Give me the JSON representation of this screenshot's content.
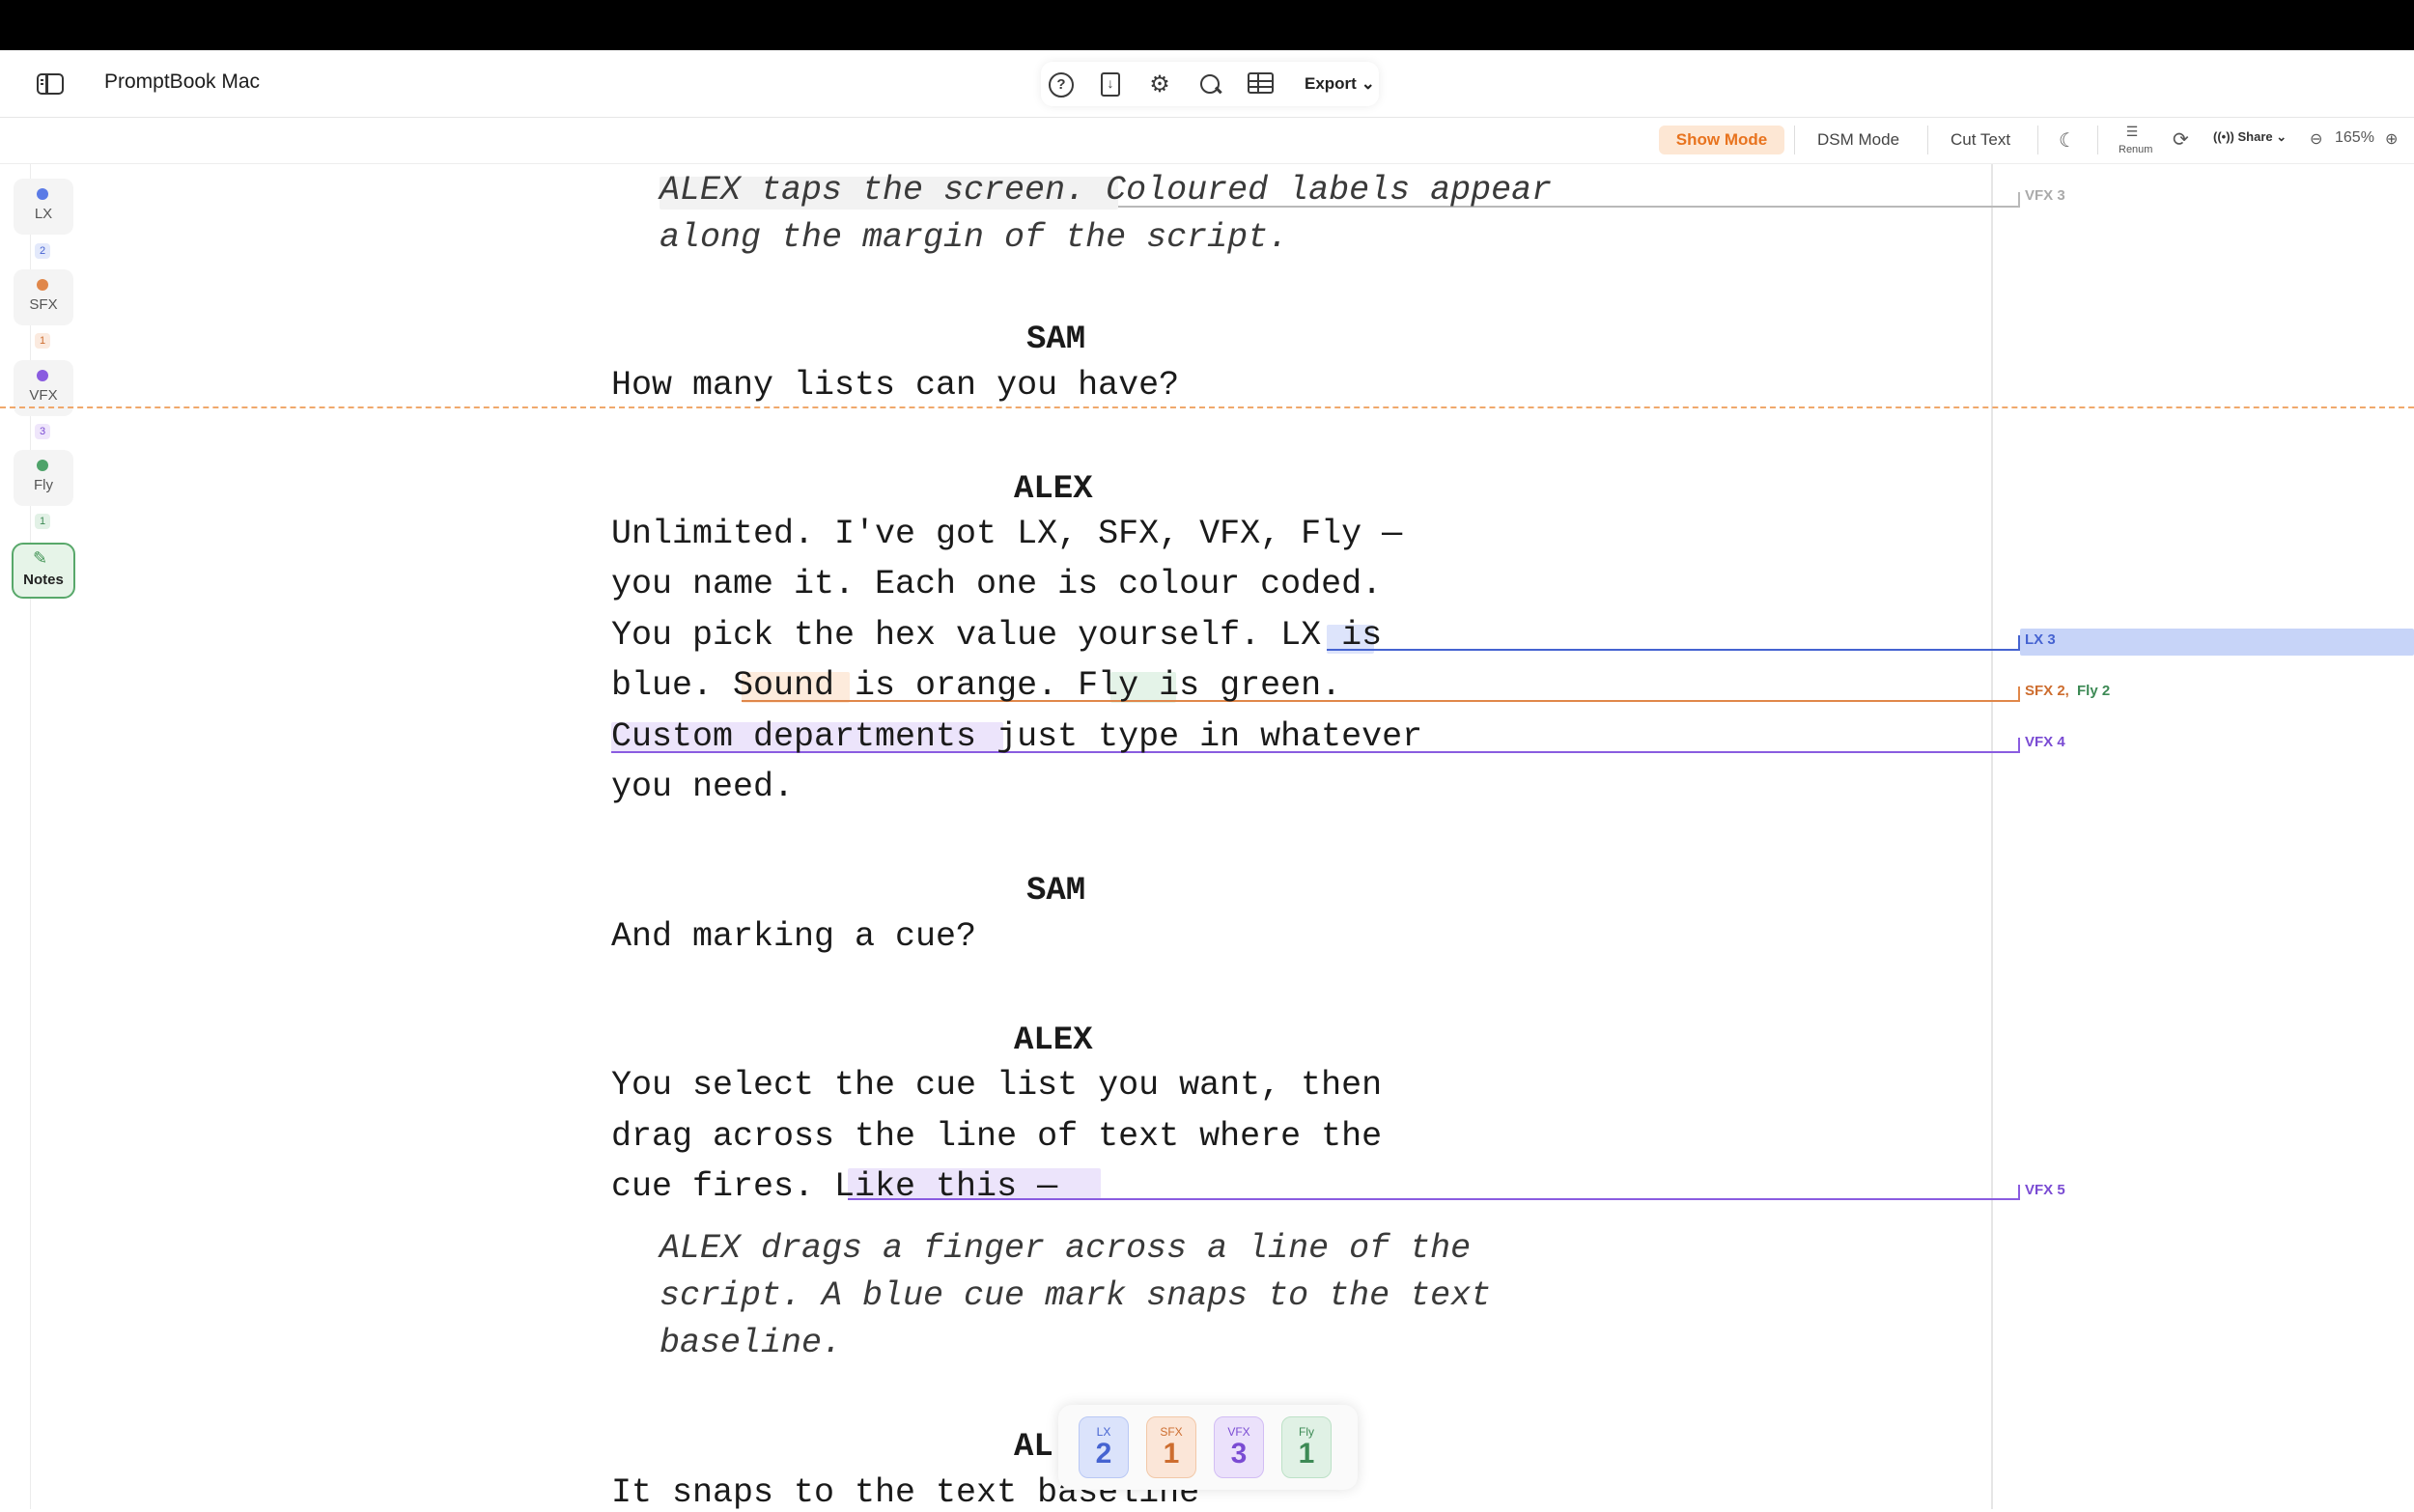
{
  "app": {
    "title": "PromptBook Mac"
  },
  "toolbar": {
    "export_label": "Export",
    "icons": [
      "help-icon",
      "import-icon",
      "gear-icon",
      "search-icon",
      "table-icon"
    ]
  },
  "modes": {
    "show": "Show Mode",
    "dsm": "DSM Mode",
    "cut": "Cut Text",
    "renum": "Renum",
    "share": "Share",
    "zoom": "165%"
  },
  "departments": [
    {
      "label": "LX",
      "count": "2",
      "color": "#5b7be6"
    },
    {
      "label": "SFX",
      "count": "1",
      "color": "#e0874a"
    },
    {
      "label": "VFX",
      "count": "3",
      "color": "#8a5ce0"
    },
    {
      "label": "Fly",
      "count": "1",
      "color": "#4fa36a"
    }
  ],
  "notes_label": "Notes",
  "script": {
    "action1": [
      "ALEX taps the screen. Coloured labels appear",
      "along the margin of the script."
    ],
    "char1": "SAM",
    "line1": "How many lists can you have?",
    "char2": "ALEX",
    "line2": [
      "Unlimited. I've got LX, SFX, VFX, Fly —",
      "you name it. Each one is colour coded.",
      "You pick the hex value yourself. LX is",
      "blue. Sound is orange. Fly is green.",
      "Custom departments just type in whatever",
      "you need."
    ],
    "char3": "SAM",
    "line3": "And marking a cue?",
    "char4": "ALEX",
    "line4": [
      "You select the cue list you want, then",
      "drag across the line of text where the",
      "cue fires. Like this —"
    ],
    "action2": [
      "ALEX drags a finger across a line of the",
      "script. A blue cue mark snaps to the text",
      "baseline."
    ],
    "char5": "AL",
    "line5": "It snaps to the text baseline"
  },
  "cues": {
    "vfx3": "VFX 3",
    "lx3": "LX 3",
    "sfx2": "SFX 2,",
    "fly2": "Fly 2",
    "vfx4": "VFX 4",
    "vfx5": "VFX 5"
  },
  "counters": [
    {
      "label": "LX",
      "num": "2"
    },
    {
      "label": "SFX",
      "num": "1"
    },
    {
      "label": "VFX",
      "num": "3"
    },
    {
      "label": "Fly",
      "num": "1"
    }
  ]
}
